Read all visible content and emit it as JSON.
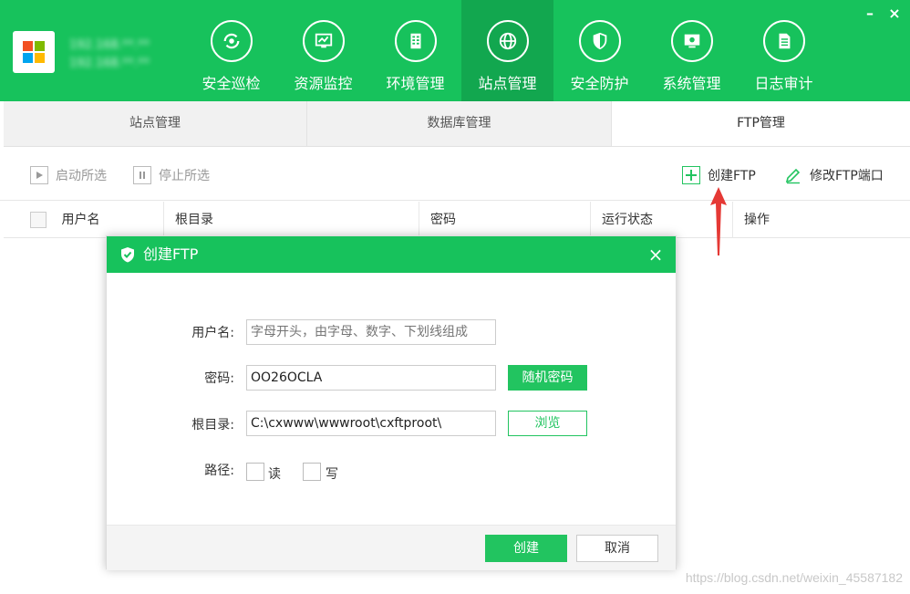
{
  "header": {
    "logo_text_line1": "192.168.**.**",
    "logo_text_line2": "192.168.**.**",
    "nav": [
      {
        "label": "安全巡检",
        "icon": "refresh-icon"
      },
      {
        "label": "资源监控",
        "icon": "monitor-icon"
      },
      {
        "label": "环境管理",
        "icon": "building-icon"
      },
      {
        "label": "站点管理",
        "icon": "globe-icon",
        "active": true
      },
      {
        "label": "安全防护",
        "icon": "shield-icon"
      },
      {
        "label": "系统管理",
        "icon": "system-icon"
      },
      {
        "label": "日志审计",
        "icon": "document-icon"
      }
    ],
    "minimize": "–",
    "close": "×"
  },
  "tabs": [
    "站点管理",
    "数据库管理",
    "FTP管理"
  ],
  "toolbar": {
    "start_selected": "启动所选",
    "stop_selected": "停止所选",
    "create_ftp": "创建FTP",
    "modify_port": "修改FTP端口"
  },
  "table": {
    "columns": [
      "用户名",
      "根目录",
      "密码",
      "运行状态",
      "操作"
    ]
  },
  "dialog": {
    "title": "创建FTP",
    "close": "×",
    "username_label": "用户名:",
    "username_placeholder": "字母开头，由字母、数字、下划线组成",
    "password_label": "密码:",
    "password_value": "OO26OCLA",
    "random_password": "随机密码",
    "root_label": "根目录:",
    "root_value": "C:\\cxwww\\wwwroot\\cxftproot\\",
    "browse": "浏览",
    "path_label": "路径:",
    "read": "读",
    "write": "写",
    "create": "创建",
    "cancel": "取消"
  },
  "watermark": "https://blog.csdn.net/weixin_45587182",
  "colors": {
    "brand": "#17c25c",
    "brand_dark": "#12a74f",
    "arrow": "#e53935"
  }
}
